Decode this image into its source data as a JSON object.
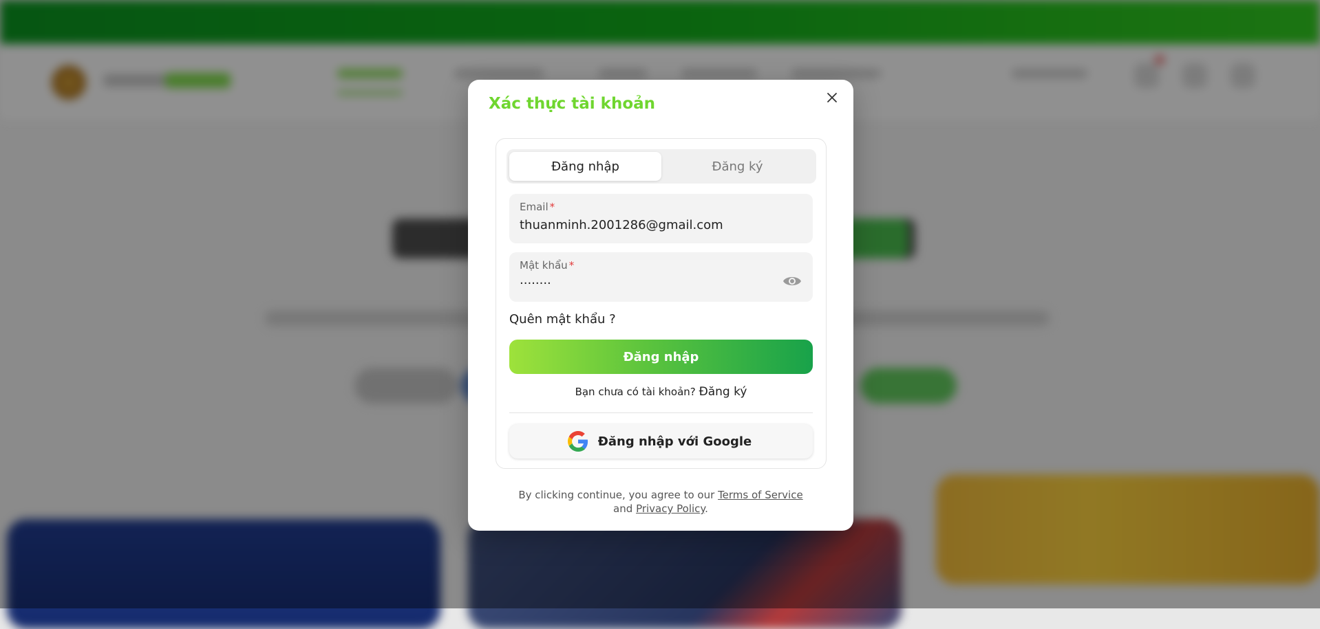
{
  "modal": {
    "title": "Xác thực tài khoản",
    "tabs": [
      {
        "label": "Đăng nhập",
        "active": true
      },
      {
        "label": "Đăng ký",
        "active": false
      }
    ],
    "email": {
      "label": "Email",
      "required_mark": "*",
      "value": "thuanminh.2001286@gmail.com"
    },
    "password": {
      "label": "Mật khẩu",
      "required_mark": "*",
      "value": "········",
      "icon": "eye-icon"
    },
    "forgot_password": "Quên mật khẩu ?",
    "login_button": "Đăng nhập",
    "no_account_text": "Bạn chưa có tài khoản?",
    "signup_link": "Đăng ký",
    "google_button": "Đăng nhập với Google",
    "terms": {
      "prefix": "By clicking continue, you agree to our",
      "tos_link": "Terms of Service",
      "and": "and",
      "privacy_link": "Privacy Policy",
      "suffix": "."
    }
  },
  "colors": {
    "title_green": "#6fd62f",
    "button_gradient_start": "#9ee23b",
    "button_gradient_end": "#18a24a",
    "top_bar_green": "#11a51a",
    "required_red": "#e23b3b"
  }
}
